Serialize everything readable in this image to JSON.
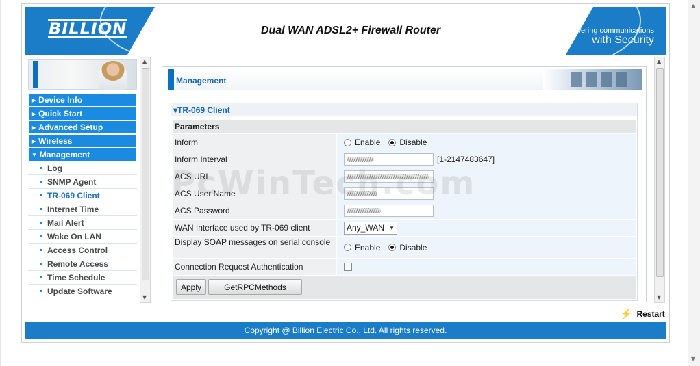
{
  "header": {
    "logo": "BILLION",
    "product_title": "Dual WAN ADSL2+ Firewall Router",
    "slogan_line1": "Powering communications",
    "slogan_line2": "with Security",
    "color": "#1b7cc7"
  },
  "sidebar": {
    "items": [
      {
        "label": "Device Info",
        "level": "top"
      },
      {
        "label": "Quick Start",
        "level": "top"
      },
      {
        "label": "Advanced Setup",
        "level": "top"
      },
      {
        "label": "Wireless",
        "level": "top"
      },
      {
        "label": "Management",
        "level": "top",
        "expanded": true
      },
      {
        "label": "Log",
        "level": "sub"
      },
      {
        "label": "SNMP Agent",
        "level": "sub"
      },
      {
        "label": "TR-069 Client",
        "level": "sub",
        "active": true
      },
      {
        "label": "Internet Time",
        "level": "sub"
      },
      {
        "label": "Mail Alert",
        "level": "sub"
      },
      {
        "label": "Wake On LAN",
        "level": "sub"
      },
      {
        "label": "Access Control",
        "level": "sub"
      },
      {
        "label": "Remote Access",
        "level": "sub"
      },
      {
        "label": "Time Schedule",
        "level": "sub"
      },
      {
        "label": "Update Software",
        "level": "sub"
      },
      {
        "label": "Backup / Update",
        "level": "sub"
      }
    ]
  },
  "main": {
    "page_title": "Management",
    "section_title": "TR-069 Client",
    "params_header": "Parameters",
    "inform": {
      "label": "Inform",
      "enable": "Enable",
      "disable": "Disable",
      "selected": "Disable"
    },
    "inform_interval": {
      "label": "Inform Interval",
      "range": "[1-2147483647]"
    },
    "acs_url": {
      "label": "ACS URL"
    },
    "acs_user": {
      "label": "ACS User Name"
    },
    "acs_password": {
      "label": "ACS Password"
    },
    "wan_interface": {
      "label": "WAN Interface used by TR-069 client",
      "value": "Any_WAN"
    },
    "soap": {
      "label": "Display SOAP messages on serial console",
      "enable": "Enable",
      "disable": "Disable",
      "selected": "Disable"
    },
    "conn_auth": {
      "label": "Connection Request Authentication",
      "checked": false
    },
    "apply_label": "Apply",
    "rpc_label": "GetRPCMethods"
  },
  "restart_label": "Restart",
  "footer": "Copyright @ Billion Electric Co., Ltd. All rights reserved.",
  "watermark": "PcWinTech.com"
}
